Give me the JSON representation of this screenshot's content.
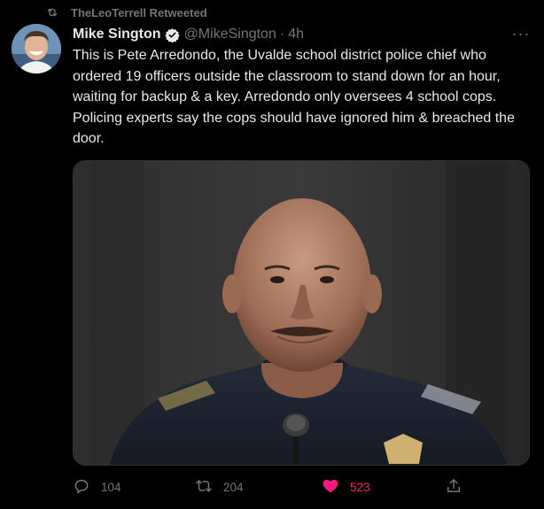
{
  "retweet_context": {
    "label": "TheLeoTerrell Retweeted"
  },
  "author": {
    "name": "Mike Sington",
    "handle": "@MikeSington",
    "separator": "·",
    "time": "4h"
  },
  "more_menu": {
    "label": "···"
  },
  "tweet": {
    "text": "This is Pete Arredondo, the Uvalde school district police chief who ordered 19 officers outside the classroom to stand down for an hour, waiting for backup & a key. Arredondo only oversees 4 school cops. Policing experts say the cops should have ignored him & breached the door."
  },
  "actions": {
    "reply_count": "104",
    "retweet_count": "204",
    "like_count": "523"
  },
  "colors": {
    "background": "#000000",
    "text": "#e7e9ea",
    "muted": "#71767b",
    "like": "#f91880",
    "verified": "#1d9bf0"
  }
}
